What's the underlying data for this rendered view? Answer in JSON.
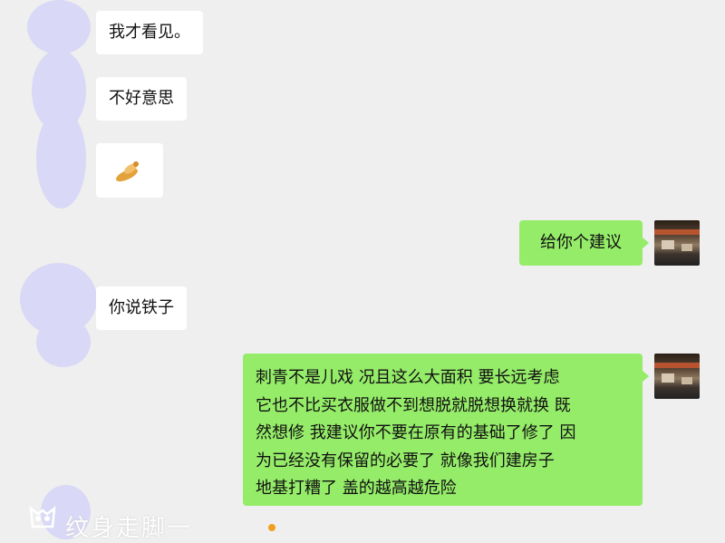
{
  "messages": [
    {
      "side": "left",
      "text": "我才看见。"
    },
    {
      "side": "left",
      "text": "不好意思"
    },
    {
      "side": "left",
      "text": "",
      "sticker": "bow-sticker"
    },
    {
      "side": "right",
      "text": "给你个建议"
    },
    {
      "side": "left",
      "text": "你说铁子"
    },
    {
      "side": "right",
      "lines": [
        "刺青不是儿戏 况且这么大面积 要长远考虑",
        "它也不比买衣服做不到想脱就脱想换就换 既",
        "然想修 我建议你不要在原有的基础了修了 因",
        "为已经没有保留的必要了  就像我们建房子",
        "地基打糟了 盖的越高越危险"
      ]
    }
  ],
  "watermark": {
    "text": "纹身走脚一"
  },
  "colors": {
    "background": "#efefef",
    "sent_bubble": "#95ec69",
    "received_bubble": "#ffffff",
    "blur_blob": "#d9d8f7"
  }
}
